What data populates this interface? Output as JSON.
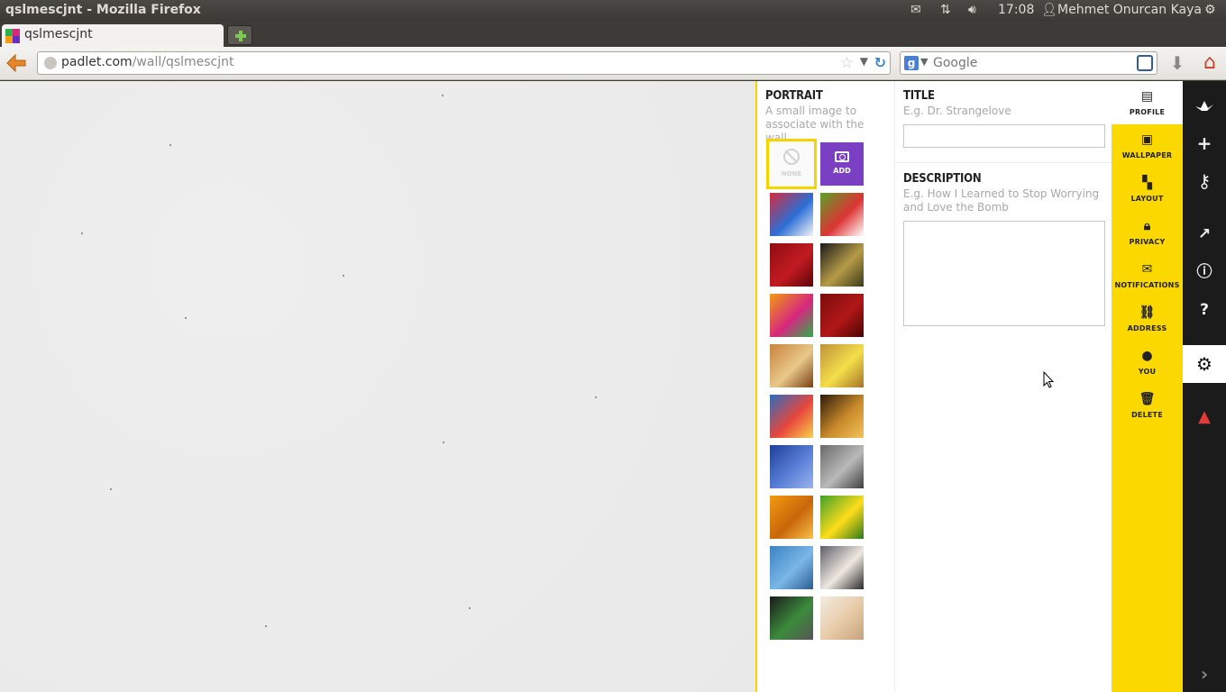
{
  "window": {
    "title": "qslmescjnt - Mozilla Firefox",
    "clock": "17:08",
    "user": "Mehmet Onurcan Kaya"
  },
  "tab": {
    "label": "qslmescjnt"
  },
  "nav": {
    "url_host": "padlet.com",
    "url_path": "/wall/qslmescjnt",
    "search_placeholder": "Google"
  },
  "portrait": {
    "heading": "PORTRAIT",
    "hint": "A small image to associate with the wall.",
    "none_label": "NONE",
    "add_label": "ADD",
    "tiles": [
      {
        "name": "paint-swirl",
        "colors": [
          "#d42a3b",
          "#2b6fd6",
          "#f5f5f5"
        ]
      },
      {
        "name": "soccer-player",
        "colors": [
          "#5aa32a",
          "#d33",
          "#ffffff"
        ]
      },
      {
        "name": "red-rose",
        "colors": [
          "#8e0c12",
          "#c21b22",
          "#5a0608"
        ]
      },
      {
        "name": "champagne-glass",
        "colors": [
          "#1a1a1a",
          "#b69b46",
          "#3a3a1a"
        ]
      },
      {
        "name": "origami-crane",
        "colors": [
          "#f39b12",
          "#d6277e",
          "#2bb04a"
        ]
      },
      {
        "name": "red-numbers",
        "colors": [
          "#7a0c0c",
          "#b21717",
          "#4a0404"
        ]
      },
      {
        "name": "notepad-pencil",
        "colors": [
          "#c8823a",
          "#e9c88a",
          "#7a3e12"
        ]
      },
      {
        "name": "sticky-note-checklist",
        "colors": [
          "#c0923b",
          "#f3df49",
          "#a67225"
        ]
      },
      {
        "name": "birthday-cake",
        "colors": [
          "#2a6ec0",
          "#e8463c",
          "#f6d24a"
        ]
      },
      {
        "name": "people-lights",
        "colors": [
          "#2b1a0a",
          "#c98a2a",
          "#f3c35a"
        ]
      },
      {
        "name": "blue-globe",
        "colors": [
          "#1f3f9a",
          "#5a7fd6",
          "#9ab3ee"
        ]
      },
      {
        "name": "pocket-watch",
        "colors": [
          "#6a6a6a",
          "#b9b9b9",
          "#3e3e3e"
        ]
      },
      {
        "name": "megaphone",
        "colors": [
          "#f39b12",
          "#c8660a",
          "#f9c24a"
        ]
      },
      {
        "name": "smiley-face",
        "colors": [
          "#3fa02b",
          "#ffdd1a",
          "#2b7a1a"
        ]
      },
      {
        "name": "justice-scales",
        "colors": [
          "#3b83c4",
          "#7ab6e6",
          "#2a5f90"
        ]
      },
      {
        "name": "wedding-couple",
        "colors": [
          "#5f5f6a",
          "#efe8e0",
          "#2a2a2a"
        ]
      },
      {
        "name": "chimpanzee",
        "colors": [
          "#1a1a1a",
          "#3c8b3c",
          "#555555"
        ]
      },
      {
        "name": "babies",
        "colors": [
          "#f3ece0",
          "#e7c9a6",
          "#c8a27e"
        ]
      }
    ]
  },
  "fields": {
    "title_heading": "TITLE",
    "title_hint": "E.g. Dr. Strangelove",
    "title_value": "",
    "desc_heading": "DESCRIPTION",
    "desc_hint": "E.g. How I Learned to Stop Worrying and Love the Bomb",
    "desc_value": ""
  },
  "menu": {
    "items": [
      {
        "label": "PROFILE",
        "icon": "profile-card-icon"
      },
      {
        "label": "WALLPAPER",
        "icon": "image-icon"
      },
      {
        "label": "LAYOUT",
        "icon": "layout-icon"
      },
      {
        "label": "PRIVACY",
        "icon": "lock-icon"
      },
      {
        "label": "NOTIFICATIONS",
        "icon": "mail-icon"
      },
      {
        "label": "ADDRESS",
        "icon": "link-icon"
      },
      {
        "label": "YOU",
        "icon": "user-icon"
      },
      {
        "label": "DELETE",
        "icon": "trash-icon"
      }
    ],
    "background": "#fbd900"
  },
  "rail": {
    "items": [
      {
        "icon": "padlet-logo-icon"
      },
      {
        "icon": "plus-icon"
      },
      {
        "icon": "key-icon"
      },
      {
        "icon": "share-icon"
      },
      {
        "icon": "info-icon"
      },
      {
        "icon": "help-icon"
      },
      {
        "icon": "gear-icon",
        "active": true
      },
      {
        "icon": "warning-icon"
      },
      {
        "icon": "chevron-right-icon"
      }
    ]
  }
}
